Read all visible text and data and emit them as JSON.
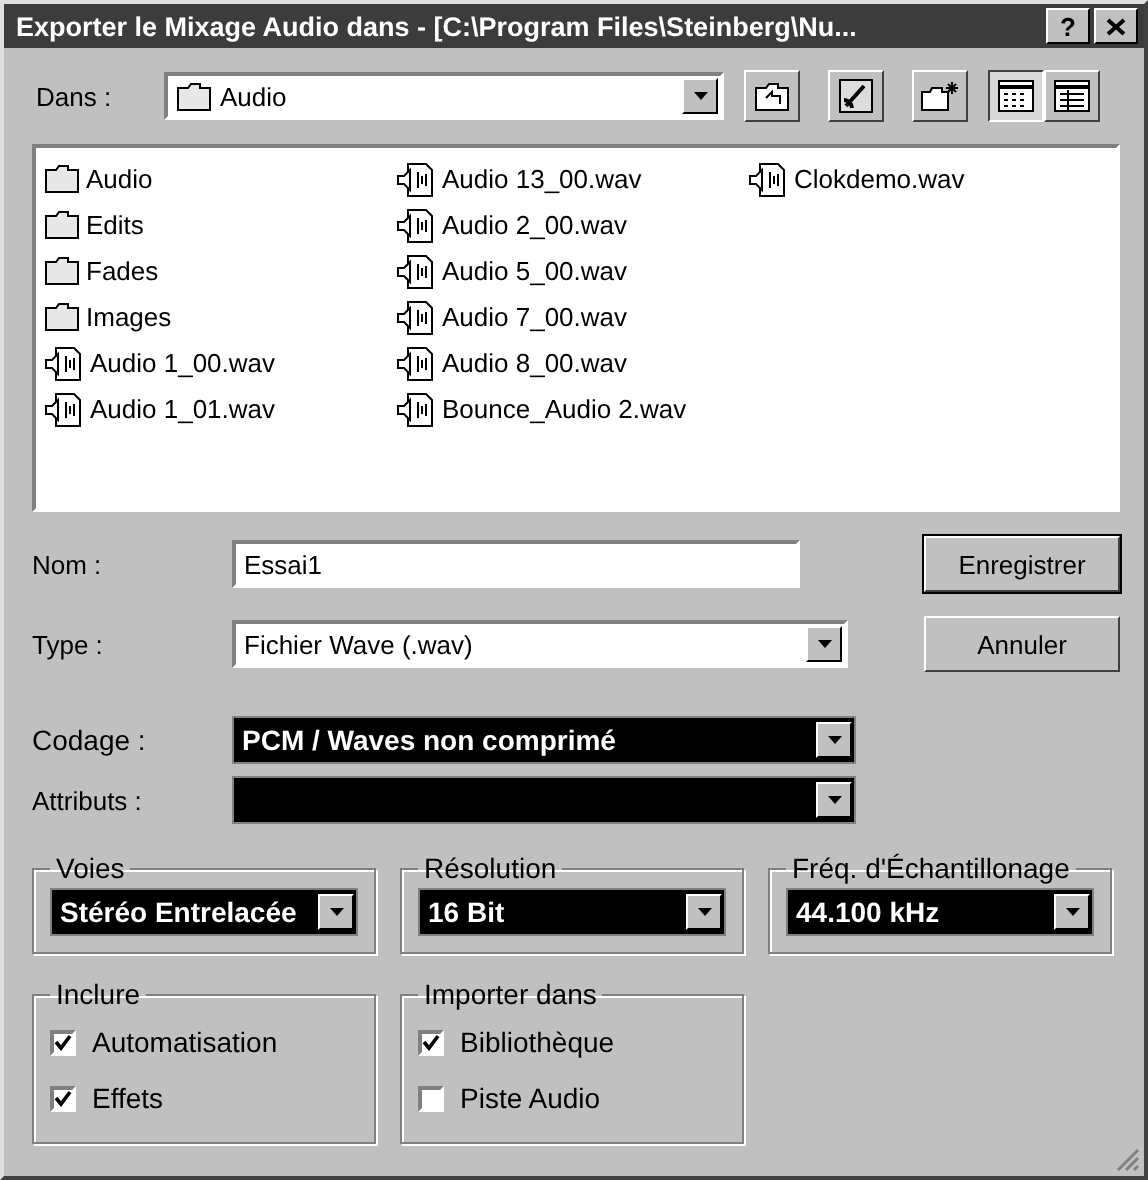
{
  "window": {
    "title": "Exporter le Mixage Audio dans - [C:\\Program Files\\Steinberg\\Nu...",
    "help_button": "?"
  },
  "location": {
    "label": "Dans :",
    "value": "Audio"
  },
  "view_buttons": [
    {
      "kind": "list",
      "selected": true
    },
    {
      "kind": "details",
      "selected": false
    }
  ],
  "files": [
    {
      "kind": "folder",
      "name": "Audio"
    },
    {
      "kind": "folder",
      "name": "Edits"
    },
    {
      "kind": "folder",
      "name": "Fades"
    },
    {
      "kind": "folder",
      "name": "Images"
    },
    {
      "kind": "wav",
      "name": "Audio 1_00.wav"
    },
    {
      "kind": "wav",
      "name": "Audio 1_01.wav"
    },
    {
      "kind": "wav",
      "name": "Audio 13_00.wav"
    },
    {
      "kind": "wav",
      "name": "Audio 2_00.wav"
    },
    {
      "kind": "wav",
      "name": "Audio 5_00.wav"
    },
    {
      "kind": "wav",
      "name": "Audio 7_00.wav"
    },
    {
      "kind": "wav",
      "name": "Audio 8_00.wav"
    },
    {
      "kind": "wav",
      "name": "Bounce_Audio 2.wav"
    },
    {
      "kind": "wav",
      "name": "Clokdemo.wav"
    }
  ],
  "name_field": {
    "label": "Nom :",
    "value": "Essai1"
  },
  "type_field": {
    "label": "Type :",
    "value": "Fichier Wave (.wav)"
  },
  "buttons": [
    "Enregistrer",
    "Annuler"
  ],
  "coding": {
    "label": "Codage :",
    "value": "PCM / Waves non comprimé"
  },
  "attributes": {
    "label": "Attributs :"
  },
  "format_groups": [
    {
      "title": "Voies",
      "value": "Stéréo Entrelacée"
    },
    {
      "title": "Résolution",
      "value": "16 Bit"
    },
    {
      "title": "Fréq. d'Échantillonage",
      "value": "44.100 kHz"
    }
  ],
  "option_groups": [
    {
      "title": "Inclure",
      "options": [
        {
          "label": "Automatisation",
          "checked": true
        },
        {
          "label": "Effets",
          "checked": true
        }
      ]
    },
    {
      "title": "Importer dans",
      "options": [
        {
          "label": "Bibliothèque",
          "checked": true
        },
        {
          "label": "Piste Audio",
          "checked": false
        }
      ]
    }
  ]
}
